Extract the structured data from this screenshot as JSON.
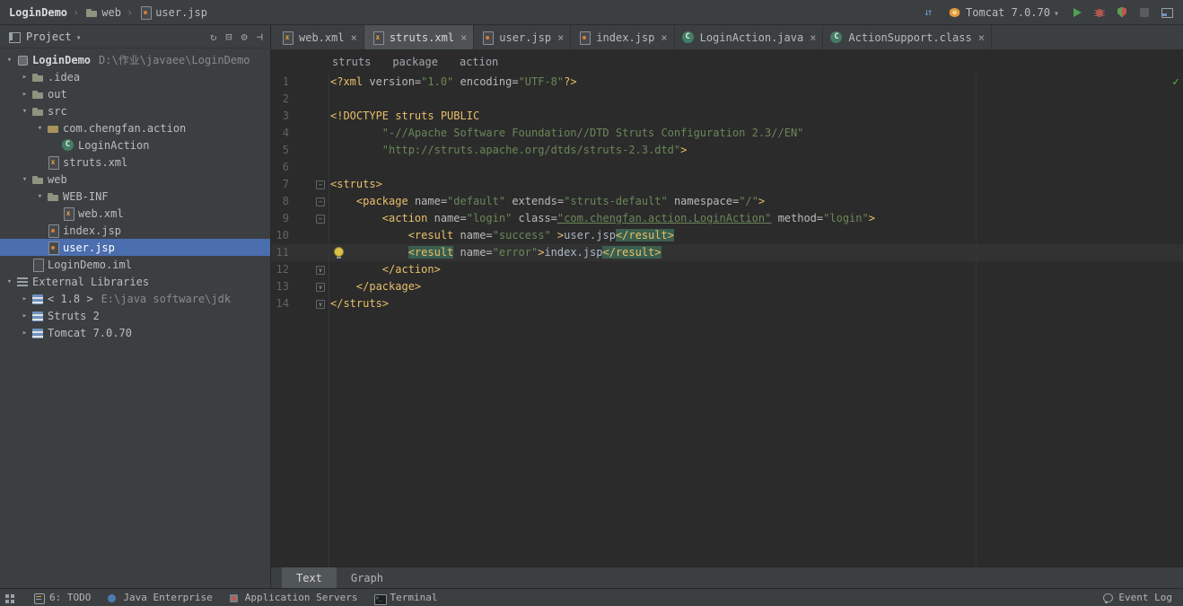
{
  "colors": {
    "panel_bg": "#3c3f41",
    "editor_bg": "#2b2b2b",
    "selection": "#4b6eaf",
    "tag": "#e8bf6a",
    "string": "#6a8759",
    "attr_name": "#bababa",
    "text": "#a9b7c6",
    "line_number": "#606366",
    "current_line": "#323232",
    "tag_match_bg": "#3a5f4e",
    "run_green": "#4da154",
    "error_red": "#c75450",
    "ok_green": "#62b543"
  },
  "topbar": {
    "separator": "›",
    "breadcrumbs": [
      {
        "label": "LoginDemo",
        "bold": true
      },
      {
        "label": "web",
        "icon": "folder"
      },
      {
        "label": "user.jsp",
        "icon": "jsp"
      }
    ],
    "run": {
      "config_label": "Tomcat 7.0.70",
      "buttons_before": [
        "update-app"
      ],
      "buttons_after": [
        "run",
        "debug",
        "coverage",
        "stop",
        "layout"
      ]
    }
  },
  "project_panel": {
    "title": "Project",
    "toolbar_icons": [
      "refresh",
      "collapse-all",
      "settings",
      "hide"
    ],
    "glyphs": {
      "refresh": "↻",
      "collapse-all": "⊟",
      "settings": "⚙",
      "hide": "⊣"
    },
    "arrow_glyphs": {
      "down": "▾",
      "right": "▸"
    },
    "tree": [
      {
        "indent": 0,
        "arrow": "down",
        "icon": "project",
        "label": "LoginDemo",
        "extra": "D:\\作业\\javaee\\LoginDemo",
        "bold": true
      },
      {
        "indent": 1,
        "arrow": "right",
        "icon": "folder",
        "label": ".idea"
      },
      {
        "indent": 1,
        "arrow": "right",
        "icon": "folder",
        "label": "out"
      },
      {
        "indent": 1,
        "arrow": "down",
        "icon": "folder",
        "label": "src"
      },
      {
        "indent": 2,
        "arrow": "down",
        "icon": "package",
        "label": "com.chengfan.action"
      },
      {
        "indent": 3,
        "arrow": "none",
        "icon": "class",
        "label": "LoginAction"
      },
      {
        "indent": 2,
        "arrow": "none",
        "icon": "xml",
        "label": "struts.xml"
      },
      {
        "indent": 1,
        "arrow": "down",
        "icon": "folder",
        "label": "web"
      },
      {
        "indent": 2,
        "arrow": "down",
        "icon": "folder",
        "label": "WEB-INF"
      },
      {
        "indent": 3,
        "arrow": "none",
        "icon": "xml",
        "label": "web.xml"
      },
      {
        "indent": 2,
        "arrow": "none",
        "icon": "jsp",
        "label": "index.jsp"
      },
      {
        "indent": 2,
        "arrow": "none",
        "icon": "jsp",
        "label": "user.jsp",
        "selected": true
      },
      {
        "indent": 1,
        "arrow": "none",
        "icon": "file",
        "label": "LoginDemo.iml"
      },
      {
        "indent": 0,
        "arrow": "down",
        "icon": "libraries",
        "label": "External Libraries"
      },
      {
        "indent": 1,
        "arrow": "right",
        "icon": "library",
        "label": "< 1.8 >",
        "extra": "E:\\java software\\jdk"
      },
      {
        "indent": 1,
        "arrow": "right",
        "icon": "library",
        "label": "Struts 2"
      },
      {
        "indent": 1,
        "arrow": "right",
        "icon": "library",
        "label": "Tomcat 7.0.70"
      }
    ]
  },
  "editor": {
    "tabs": [
      {
        "label": "web.xml",
        "icon": "xml",
        "active": false
      },
      {
        "label": "struts.xml",
        "icon": "xml",
        "active": true
      },
      {
        "label": "user.jsp",
        "icon": "jsp",
        "active": false
      },
      {
        "label": "index.jsp",
        "icon": "jsp",
        "active": false
      },
      {
        "label": "LoginAction.java",
        "icon": "class",
        "active": false
      },
      {
        "label": "ActionSupport.class",
        "icon": "class",
        "active": false
      }
    ],
    "breadcrumbs": [
      "struts",
      "package",
      "action"
    ],
    "code": {
      "fold_glyphs": {
        "start": "−",
        "end": "∨"
      },
      "lines": [
        {
          "n": "1",
          "tokens": [
            [
              "tag",
              "<?xml "
            ],
            [
              "attr",
              "version="
            ],
            [
              "str",
              "\"1.0\""
            ],
            [
              "plain",
              " "
            ],
            [
              "attr",
              "encoding="
            ],
            [
              "str",
              "\"UTF-8\""
            ],
            [
              "tag",
              "?>"
            ]
          ]
        },
        {
          "n": "2",
          "tokens": []
        },
        {
          "n": "3",
          "tokens": [
            [
              "tag",
              "<!DOCTYPE struts PUBLIC"
            ]
          ]
        },
        {
          "n": "4",
          "tokens": [
            [
              "plain",
              "        "
            ],
            [
              "str",
              "\"-//Apache Software Foundation//DTD Struts Configuration 2.3//EN\""
            ]
          ]
        },
        {
          "n": "5",
          "tokens": [
            [
              "plain",
              "        "
            ],
            [
              "str",
              "\"http://struts.apache.org/dtds/struts-2.3.dtd\""
            ],
            [
              "tag",
              ">"
            ]
          ]
        },
        {
          "n": "6",
          "tokens": []
        },
        {
          "n": "7",
          "fold": "start",
          "tokens": [
            [
              "tag",
              "<struts>"
            ]
          ]
        },
        {
          "n": "8",
          "fold": "start",
          "tokens": [
            [
              "plain",
              "    "
            ],
            [
              "tag",
              "<package"
            ],
            [
              "plain",
              " "
            ],
            [
              "attr",
              "name="
            ],
            [
              "str",
              "\"default\""
            ],
            [
              "plain",
              " "
            ],
            [
              "attr",
              "extends="
            ],
            [
              "str",
              "\"struts-default\""
            ],
            [
              "plain",
              " "
            ],
            [
              "attr",
              "namespace="
            ],
            [
              "str",
              "\"/\""
            ],
            [
              "tag",
              ">"
            ]
          ]
        },
        {
          "n": "9",
          "fold": "start",
          "tokens": [
            [
              "plain",
              "        "
            ],
            [
              "tag",
              "<action"
            ],
            [
              "plain",
              " "
            ],
            [
              "attr",
              "name="
            ],
            [
              "str",
              "\"login\""
            ],
            [
              "plain",
              " "
            ],
            [
              "attr",
              "class="
            ],
            [
              "strlink",
              "\"com.chengfan.action.LoginAction\""
            ],
            [
              "plain",
              " "
            ],
            [
              "attr",
              "method="
            ],
            [
              "str",
              "\"login\""
            ],
            [
              "tag",
              ">"
            ]
          ]
        },
        {
          "n": "10",
          "tokens": [
            [
              "plain",
              "            "
            ],
            [
              "tag",
              "<result"
            ],
            [
              "plain",
              " "
            ],
            [
              "attr",
              "name="
            ],
            [
              "str",
              "\"success\""
            ],
            [
              "plain",
              " "
            ],
            [
              "tag",
              ">"
            ],
            [
              "plain",
              "user.jsp"
            ],
            [
              "taghl",
              "</result>"
            ]
          ]
        },
        {
          "n": "11",
          "current": true,
          "bulb": true,
          "tokens": [
            [
              "plain",
              "            "
            ],
            [
              "taghl",
              "<result"
            ],
            [
              "plain",
              " "
            ],
            [
              "attr",
              "name="
            ],
            [
              "str",
              "\"error\""
            ],
            [
              "tag",
              ">"
            ],
            [
              "plain",
              "index.jsp"
            ],
            [
              "taghl",
              "</result>"
            ]
          ]
        },
        {
          "n": "12",
          "fold": "end",
          "tokens": [
            [
              "plain",
              "        "
            ],
            [
              "tag",
              "</action>"
            ]
          ]
        },
        {
          "n": "13",
          "fold": "end",
          "tokens": [
            [
              "plain",
              "    "
            ],
            [
              "tag",
              "</package>"
            ]
          ]
        },
        {
          "n": "14",
          "fold": "end",
          "tokens": [
            [
              "tag",
              "</struts>"
            ]
          ]
        }
      ]
    },
    "bottom_tabs": [
      {
        "label": "Text",
        "active": true
      },
      {
        "label": "Graph",
        "active": false
      }
    ]
  },
  "status_bar": {
    "left": [
      {
        "icon": "tool-switcher",
        "label": ""
      },
      {
        "icon": "todo",
        "label": "6: TODO"
      },
      {
        "icon": "javaee",
        "label": "Java Enterprise"
      },
      {
        "icon": "app-servers",
        "label": "Application Servers"
      },
      {
        "icon": "terminal",
        "label": "Terminal"
      }
    ],
    "right": [
      {
        "icon": "event-log",
        "label": "Event Log"
      }
    ]
  }
}
